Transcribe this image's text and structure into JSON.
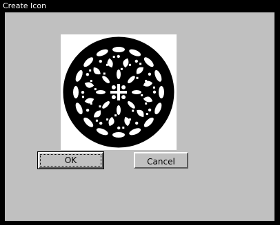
{
  "window": {
    "title": "Create Icon"
  },
  "preview": {
    "icon": "ornamental-rosette-icon"
  },
  "buttons": {
    "ok_label": "OK",
    "cancel_label": "Cancel"
  },
  "colors": {
    "titlebar": "#000000",
    "face": "#c0c0c0",
    "preview_bg": "#ffffff",
    "glyph": "#000000"
  }
}
